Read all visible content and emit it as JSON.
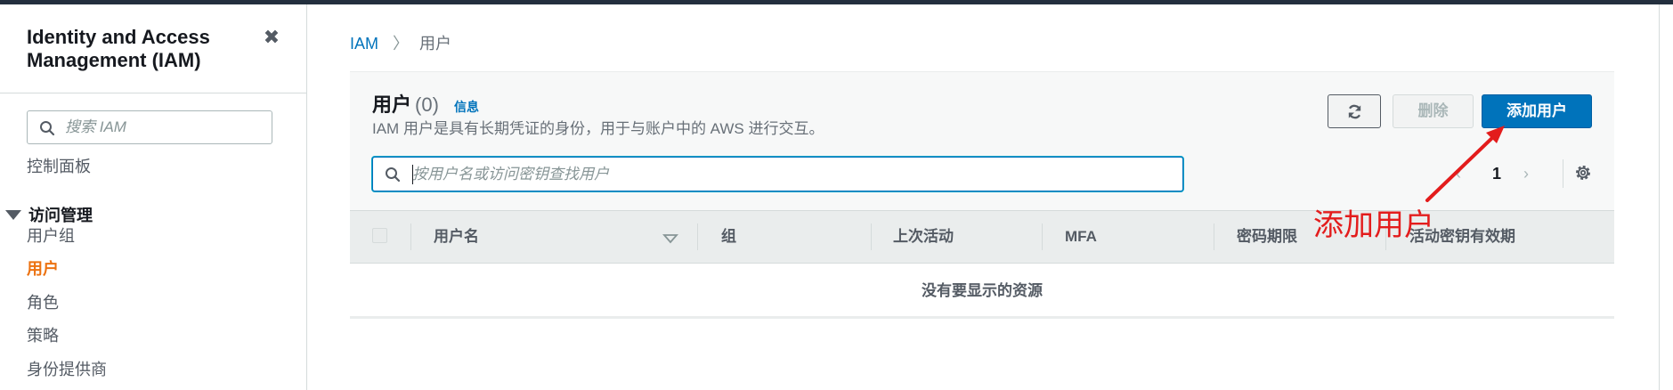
{
  "sidebar": {
    "title": "Identity and Access Management (IAM)",
    "close_icon": "close-icon",
    "search_placeholder": "搜索 IAM",
    "dashboard": "控制面板",
    "section_access": "访问管理",
    "items": [
      {
        "label": "用户组",
        "active": false
      },
      {
        "label": "用户",
        "active": true
      },
      {
        "label": "角色",
        "active": false
      },
      {
        "label": "策略",
        "active": false
      },
      {
        "label": "身份提供商",
        "active": false
      }
    ]
  },
  "breadcrumb": {
    "root": "IAM",
    "current": "用户"
  },
  "panel": {
    "title": "用户",
    "count": "(0)",
    "info_link": "信息",
    "description": "IAM 用户是具有长期凭证的身份，用于与账户中的 AWS 进行交互。",
    "refresh_icon": "refresh-icon",
    "delete_label": "删除",
    "add_label": "添加用户",
    "search_placeholder": "按用户名或访问密钥查找用户",
    "pager": {
      "prev": "‹",
      "page": "1",
      "next": "›"
    },
    "settings_icon": "gear-icon"
  },
  "table": {
    "columns": [
      "用户名",
      "组",
      "上次活动",
      "MFA",
      "密码期限",
      "活动密钥有效期"
    ],
    "empty_message": "没有要显示的资源"
  },
  "annotation": {
    "text": "添加用户",
    "color": "#e31c1c"
  },
  "colors": {
    "primary": "#0073bb",
    "active_nav": "#ec7211",
    "topbar": "#232f3e"
  }
}
